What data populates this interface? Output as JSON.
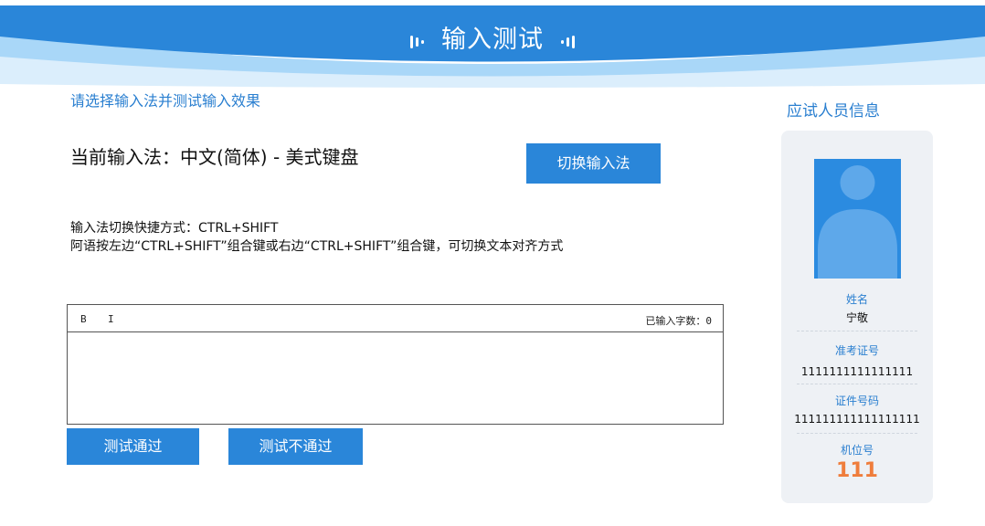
{
  "header": {
    "title": "输入测试"
  },
  "main": {
    "instruction": "请选择输入法并测试输入效果",
    "current_ime_text": "当前输入法：中文(简体) - 美式键盘",
    "switch_button": "切换输入法",
    "hint_line1": "输入法切换快捷方式：CTRL+SHIFT",
    "hint_line2": "阿语按左边“CTRL+SHIFT”组合键或右边“CTRL+SHIFT”组合键，可切换文本对齐方式",
    "editor": {
      "bold": "B",
      "italic": "I",
      "char_count": "已输入字数：0",
      "content": ""
    },
    "pass_button": "测试通过",
    "fail_button": "测试不通过"
  },
  "candidate": {
    "title": "应试人员信息",
    "name_label": "姓名",
    "name": "宁敬",
    "exam_id_label": "准考证号",
    "exam_id": "1111111111111111",
    "id_number_label": "证件号码",
    "id_number": "111111111111111111",
    "seat_label": "机位号",
    "seat": "111"
  },
  "colors": {
    "brand_blue": "#2a86d9",
    "seat_orange": "#ef7d3c"
  }
}
